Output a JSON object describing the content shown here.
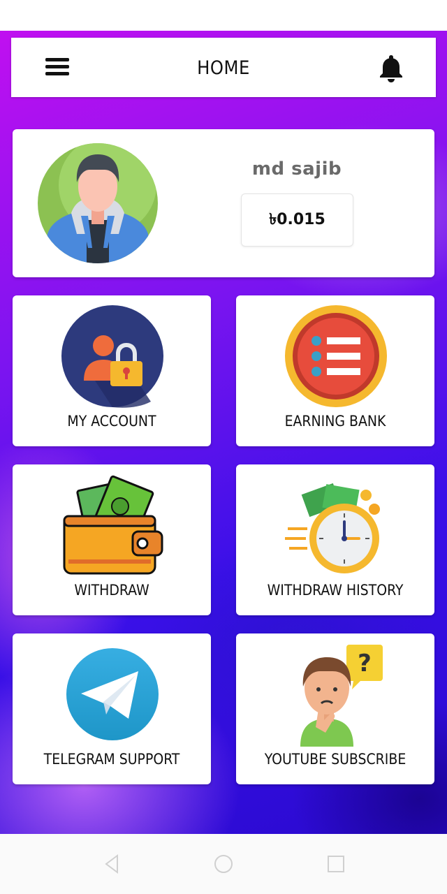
{
  "appbar": {
    "title": "HOME",
    "menu_icon": "hamburger-menu-icon",
    "notification_icon": "bell-icon"
  },
  "profile": {
    "username": "md sajib",
    "balance": "৳0.015",
    "avatar_icon": "user-avatar-icon"
  },
  "tiles": [
    {
      "label": "MY ACCOUNT",
      "icon": "account-lock-icon"
    },
    {
      "label": "EARNING BANK",
      "icon": "list-icon"
    },
    {
      "label": "WITHDRAW",
      "icon": "wallet-icon"
    },
    {
      "label": "WITHDRAW HISTORY",
      "icon": "clock-money-icon"
    },
    {
      "label": "TELEGRAM SUPPORT",
      "icon": "telegram-icon"
    },
    {
      "label": "YOUTUBE SUBSCRIBE",
      "icon": "thinking-person-icon"
    }
  ],
  "navbar": {
    "back_icon": "back-icon",
    "home_icon": "home-icon",
    "recents_icon": "recents-icon"
  },
  "colors": {
    "background_start": "#c010f0",
    "background_end": "#2a0ad0",
    "card": "#ffffff"
  }
}
